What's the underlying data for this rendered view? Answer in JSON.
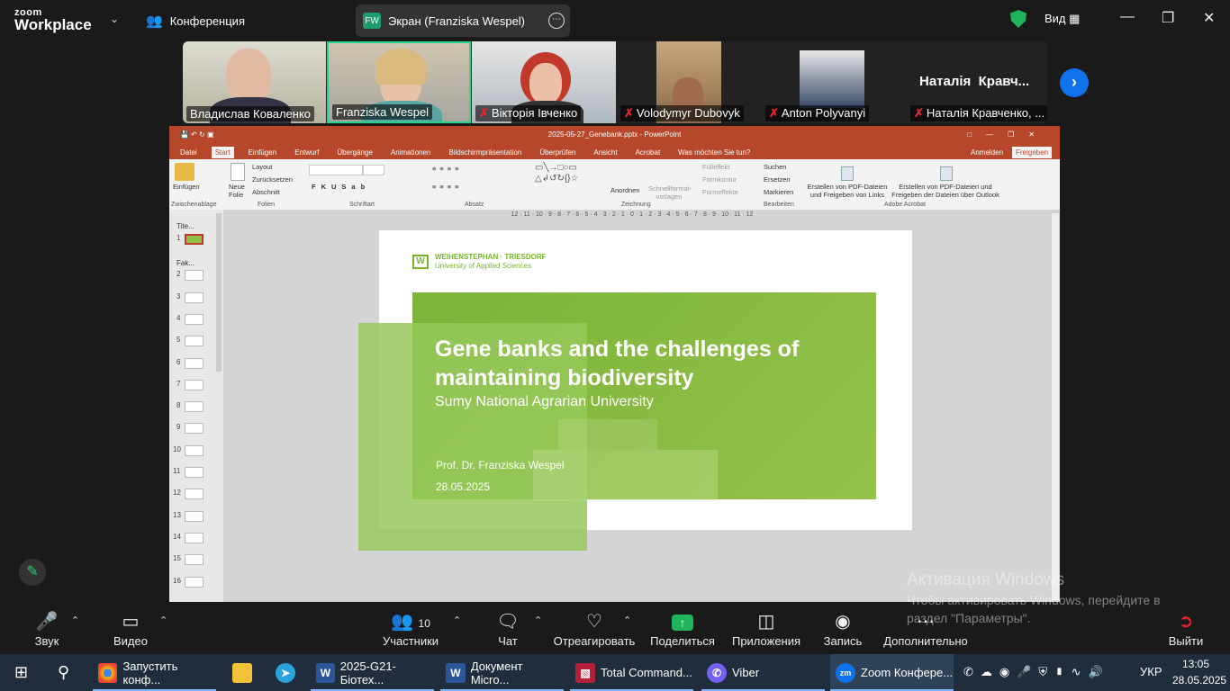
{
  "app": {
    "logo_top": "zoom",
    "logo_bottom": "Workplace",
    "meeting_label": "Конференция"
  },
  "share": {
    "badge": "FW",
    "label": "Экран (Franziska Wespel)"
  },
  "view": {
    "label": "Вид"
  },
  "participants_strip": [
    {
      "name": "Владислав Коваленко",
      "muted": false
    },
    {
      "name": "Franziska Wespel",
      "muted": false
    },
    {
      "name": "Вікторія Івченко",
      "muted": true
    },
    {
      "name": "Volodymyr Dubovyk",
      "muted": true
    },
    {
      "name": "Anton Polyvanyi",
      "muted": true
    },
    {
      "name": "Наталія Кравченко, ...",
      "muted": true
    }
  ],
  "big_name": "Наталія  Кравч...",
  "ppt": {
    "title": "2025-05-27_Genebank.pptx - PowerPoint",
    "tabs": [
      "Datei",
      "Start",
      "Einfügen",
      "Entwurf",
      "Übergänge",
      "Animationen",
      "Bildschirmpräsentation",
      "Überprüfen",
      "Ansicht",
      "Acrobat",
      "Was möchten Sie tun?"
    ],
    "right": {
      "signin": "Anmelden",
      "share": "Freigeben"
    },
    "ribbon": {
      "paste": "Einfügen",
      "new_slide": "Neue Folie",
      "layout": "Layout",
      "reset": "Zurücksetzen",
      "section": "Abschnitt",
      "arrange": "Anordnen",
      "quick_styles": "Schnellformat-vorlagen",
      "fill": "Fülleffekt",
      "outline": "Formkontur",
      "effects": "Formeffekte",
      "find": "Suchen",
      "replace": "Ersetzen",
      "select": "Markieren",
      "pdf1": "Erstellen von PDF-Dateien und Freigeben von Links",
      "pdf2": "Erstellen von PDF-Dateien und Freigeben der Dateien über Outlook",
      "groups": [
        "Zwischenablage",
        "Folien",
        "Schriftart",
        "Absatz",
        "Zeichnung",
        "Bearbeiten",
        "Adobe Acrobat"
      ]
    },
    "sections": [
      "Tite...",
      "Fak..."
    ],
    "slide_numbers": [
      "1",
      "2",
      "3",
      "4",
      "5",
      "6",
      "7",
      "8",
      "9",
      "10",
      "11",
      "12",
      "13",
      "14",
      "15",
      "16"
    ],
    "ruler": "12 · 11 · 10 · 9 · 8 · 7 · 6 · 5 · 4 · 3 · 2 · 1 · 0 · 1 · 2 · 3 · 4 · 5 · 6 · 7 · 8 · 9 · 10 · 11 · 12",
    "slide": {
      "logo_line1": "WEIHENSTEPHAN · TRIESDORF",
      "logo_line2": "University of Applied Sciences",
      "title_line1": "Gene banks and the challenges of",
      "title_line2": "maintaining biodiversity",
      "subtitle": "Sumy National Agrarian University",
      "author": "Prof. Dr. Franziska Wespel",
      "date": "28.05.2025"
    }
  },
  "toolbar": {
    "audio": "Звук",
    "video": "Видео",
    "participants": "Участники",
    "participants_count": "10",
    "chat": "Чат",
    "react": "Отреагировать",
    "share": "Поделиться",
    "apps": "Приложения",
    "record": "Запись",
    "more": "Дополнительно",
    "leave": "Выйти"
  },
  "watermark": {
    "title": "Активация Windows",
    "text": "Чтобы активировать Windows, перейдите в раздел \"Параметры\"."
  },
  "taskbar": {
    "items": [
      "Запустить конф...",
      "",
      "",
      "2025-G21-Біотех...",
      "Документ Micro...",
      "Total Command...",
      "Viber",
      "Zoom Конфере..."
    ],
    "lang": "УКР",
    "time": "13:05",
    "date": "28.05.2025"
  }
}
